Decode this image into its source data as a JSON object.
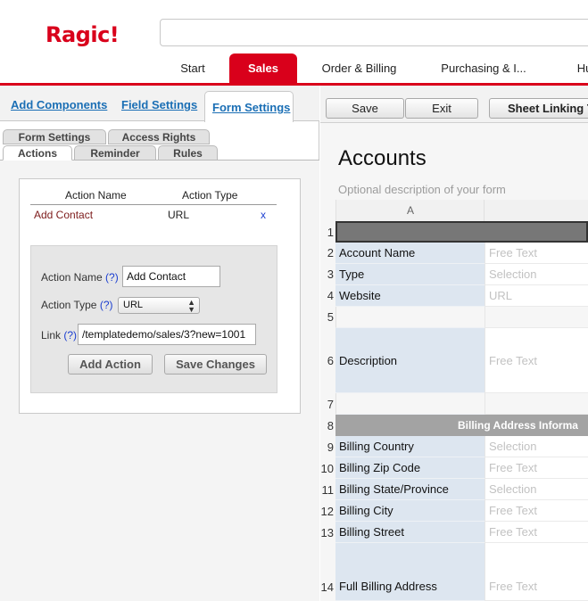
{
  "app": {
    "logo": "Ragic!"
  },
  "nav": {
    "tabs": [
      {
        "label": "Start"
      },
      {
        "label": "Sales"
      },
      {
        "label": "Order & Billing"
      },
      {
        "label": "Purchasing & I..."
      },
      {
        "label": "Hu"
      }
    ],
    "active_tab": "Sales"
  },
  "design_tabs": [
    {
      "label": "Add Components"
    },
    {
      "label": "Field Settings"
    },
    {
      "label": "Form Settings"
    }
  ],
  "settings_tabs": {
    "row1": [
      {
        "label": "Form Settings"
      },
      {
        "label": "Access Rights"
      }
    ],
    "row2": [
      {
        "label": "Actions"
      },
      {
        "label": "Reminder"
      },
      {
        "label": "Rules"
      }
    ]
  },
  "actions": {
    "headers": {
      "name": "Action Name",
      "type": "Action Type"
    },
    "rows": [
      {
        "name": "Add Contact",
        "type": "URL",
        "remove": "x"
      }
    ],
    "form": {
      "name_label": "Action Name",
      "type_label": "Action Type",
      "link_label": "Link",
      "help": "(?)",
      "name_value": "Add Contact",
      "type_value": "URL",
      "link_value": "/templatedemo/sales/3?new=1001",
      "add_button": "Add Action",
      "save_button": "Save Changes"
    }
  },
  "toolbar": {
    "save": "Save",
    "exit": "Exit",
    "sheet_linking": "Sheet Linking T"
  },
  "sheet": {
    "title": "Accounts",
    "description": "Optional description of your form",
    "column_a": "A",
    "rows": [
      {
        "num": "1",
        "kind": "header"
      },
      {
        "num": "2",
        "label": "Account Name",
        "field": "Free Text"
      },
      {
        "num": "3",
        "label": "Type",
        "field": "Selection"
      },
      {
        "num": "4",
        "label": "Website",
        "field": "URL"
      },
      {
        "num": "5",
        "label": "",
        "field": ""
      },
      {
        "num": "6",
        "label": "Description",
        "field": "Free Text"
      },
      {
        "num": "7",
        "label": "",
        "field": ""
      },
      {
        "num": "8",
        "kind": "section",
        "label": "Billing Address Informa"
      },
      {
        "num": "9",
        "label": "Billing Country",
        "field": "Selection"
      },
      {
        "num": "10",
        "label": "Billing Zip Code",
        "field": "Free Text"
      },
      {
        "num": "11",
        "label": "Billing State/Province",
        "field": "Selection"
      },
      {
        "num": "12",
        "label": "Billing City",
        "field": "Free Text"
      },
      {
        "num": "13",
        "label": "Billing Street",
        "field": "Free Text"
      },
      {
        "num": "14",
        "label": "Full Billing Address",
        "field": "Free Text"
      }
    ]
  },
  "colors": {
    "brand_red": "#d9001b",
    "link_blue": "#1b6fb5",
    "label_cell": "#dde6f0",
    "header_bar": "#777777",
    "section_bar": "#a3a3a3"
  }
}
